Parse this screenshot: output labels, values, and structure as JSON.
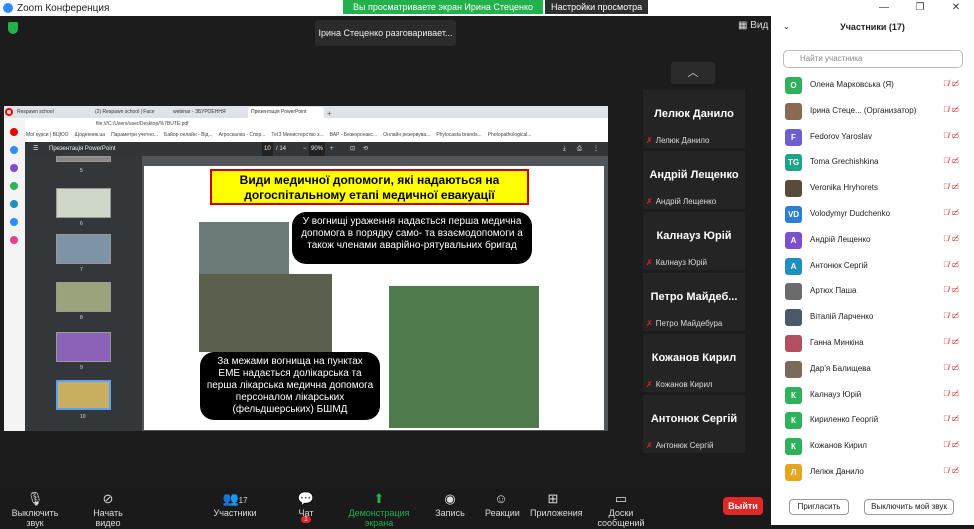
{
  "window": {
    "title": "Zoom Конференция",
    "minimize": "—",
    "restore": "❐",
    "close": "✕"
  },
  "share_banner": {
    "message": "Вы просматриваете экран Ирина Стеценко",
    "options": "Настройки просмотра"
  },
  "speaking_indicator": "Ірина Стеценко разговаривает...",
  "view_button": "Вид",
  "browser": {
    "tabs": [
      "Respawn school",
      "(2) Respawn school | Face",
      "webinar - ЗБУРОЕННЯ",
      "Презентація PowerPoint"
    ],
    "url": "file:///C:/Users/user/Desktop/%7BUTE.pdf",
    "bookmarks": [
      "Мої курси | ВЦЮО",
      "Щоденник.ua",
      "Параметри учетно...",
      "Байор онлайн - Від...",
      "Агроскалка - Спор...",
      "ТеІЗ Министерство з...",
      "ВАР - Безкоронакс...",
      "Онлайн резервува...",
      "Phylocasta brands...",
      "Photopathological..."
    ],
    "pdf_title": "Презентація PowerPoint",
    "page": "10",
    "page_total": "/ 14",
    "zoom": "90%",
    "thumb_numbers": [
      "5",
      "6",
      "7",
      "8",
      "9",
      "10"
    ]
  },
  "slide": {
    "title": "Види медичної допомоги, які надаються на догоспітальному етапі медичної евакуації",
    "bubble1": "У вогнищі ураження надається перша медична допомога в порядку само- та взаємодопомоги а також членами аварійно-рятувальних бригад",
    "bubble2": "За межами вогнища на пунктах ЕМЕ надається долікарська та перша лікарська медична допомога персоналом лікарських (фельдшерських) БШМД"
  },
  "video_tiles": [
    {
      "big": "Лелюк Данило",
      "small": "Лелюк Данило"
    },
    {
      "big": "Андрій Лещенко",
      "small": "Андрій Лещенко"
    },
    {
      "big": "Калнауз Юрій",
      "small": "Калнауз Юрій"
    },
    {
      "big": "Петро Майдеб...",
      "small": "Петро Майдебура"
    },
    {
      "big": "Кожанов Кирил",
      "small": "Кожанов Кирил"
    },
    {
      "big": "Антонюк Сергій",
      "small": "Антонюк Сергій"
    }
  ],
  "participants_panel": {
    "title": "Участники (17)",
    "search_placeholder": "Найти участника",
    "invite": "Пригласить",
    "mute_me": "Выключить мой звук",
    "list": [
      {
        "initial": "О",
        "color": "#2fb15a",
        "name": "Олена Марковська (Я)"
      },
      {
        "initial": "",
        "color": "#8a6a52",
        "name": "Ірина Стеце... (Организатор)"
      },
      {
        "initial": "F",
        "color": "#6b5fd3",
        "name": "Fedorov Yaroslav"
      },
      {
        "initial": "TG",
        "color": "#1fa38a",
        "name": "Toma Grechishkina"
      },
      {
        "initial": "",
        "color": "#5a4a3a",
        "name": "Veronika Hryhorets"
      },
      {
        "initial": "VD",
        "color": "#2d7fd3",
        "name": "Volodymyr Dudchenko"
      },
      {
        "initial": "А",
        "color": "#7d4fcf",
        "name": "Андрій Лещенко"
      },
      {
        "initial": "А",
        "color": "#1f8fbf",
        "name": "Антонюк Сергій"
      },
      {
        "initial": "",
        "color": "#6b6b6b",
        "name": "Артюх Паша"
      },
      {
        "initial": "",
        "color": "#4a5a6a",
        "name": "Віталій Ларченко"
      },
      {
        "initial": "",
        "color": "#b05060",
        "name": "Ганна Минкіна"
      },
      {
        "initial": "",
        "color": "#7a6a5a",
        "name": "Дар'я Балищева"
      },
      {
        "initial": "К",
        "color": "#2fb15a",
        "name": "Калнауз Юрій"
      },
      {
        "initial": "К",
        "color": "#2fb15a",
        "name": "Кириленко Георгій"
      },
      {
        "initial": "К",
        "color": "#2fb15a",
        "name": "Кожанов Кирил"
      },
      {
        "initial": "Л",
        "color": "#e6a51e",
        "name": "Лелюк Данило"
      }
    ]
  },
  "toolbar": {
    "mute": "Выключить звук",
    "video": "Начать видео",
    "participants": "Участники",
    "participants_count": "17",
    "chat": "Чат",
    "chat_badge": "1",
    "share": "Демонстрация экрана",
    "record": "Запись",
    "reactions": "Реакции",
    "apps": "Приложения",
    "whiteboards": "Доски сообщений",
    "leave": "Выйти"
  }
}
